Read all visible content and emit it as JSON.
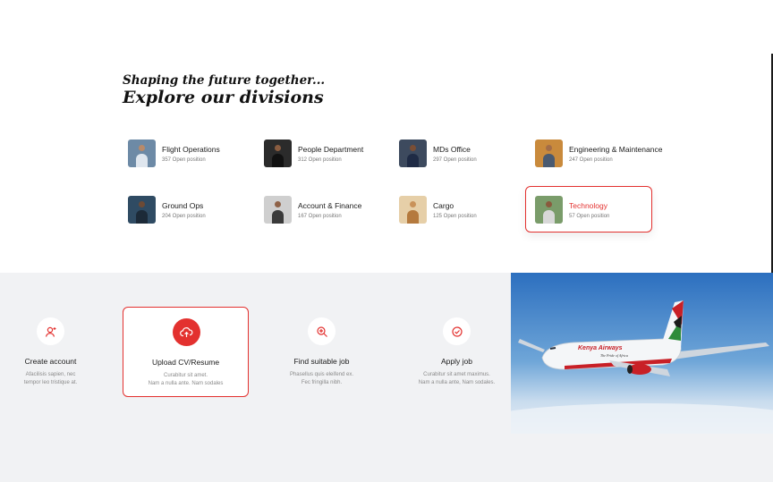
{
  "header": {
    "tagline": "Shaping the future together...",
    "title": "Explore our divisions"
  },
  "divisions": [
    {
      "name": "Flight Operations",
      "count": "357 Open position",
      "thumb_bg": "#6d8aa6",
      "fig": "#dfe6ee",
      "head": "#b88a6a"
    },
    {
      "name": "People Department",
      "count": "312 Open position",
      "thumb_bg": "#2b2b2b",
      "fig": "#111111",
      "head": "#8a5c40"
    },
    {
      "name": "MDs Office",
      "count": "297 Open position",
      "thumb_bg": "#3d4a5e",
      "fig": "#1f2b45",
      "head": "#7a4e35"
    },
    {
      "name": "Engineering & Maintenance",
      "count": "247 Open position",
      "thumb_bg": "#c98a3c",
      "fig": "#4a5a70",
      "head": "#a36d48"
    },
    {
      "name": "Ground Ops",
      "count": "204 Open position",
      "thumb_bg": "#2f4b63",
      "fig": "#1c2a38",
      "head": "#6d4a35"
    },
    {
      "name": "Account & Finance",
      "count": "167 Open position",
      "thumb_bg": "#cfcfcf",
      "fig": "#3a3a3a",
      "head": "#8f6248"
    },
    {
      "name": "Cargo",
      "count": "125 Open position",
      "thumb_bg": "#e6cfa8",
      "fig": "#b57a3e",
      "head": "#c9925a"
    },
    {
      "name": "Technology",
      "count": "57 Open position",
      "thumb_bg": "#7a9c6a",
      "fig": "#d8d8d8",
      "head": "#8a5a3d"
    }
  ],
  "steps": [
    {
      "title": "Create account",
      "desc1": "Afacilisis sapien, nec",
      "desc2": "tempor leo tristique at.",
      "icon": "add-user-icon"
    },
    {
      "title": "Upload CV/Resume",
      "desc1": "Curabitur sit amet.",
      "desc2": "Nam a nulla ante. Nam sodales",
      "icon": "cloud-upload-icon"
    },
    {
      "title": "Find suitable job",
      "desc1": "Phasellus quis eleifend ex.",
      "desc2": "Fec fringilla nibh.",
      "icon": "search-plus-icon"
    },
    {
      "title": "Apply job",
      "desc1": "Curabitur sit amet maximus.",
      "desc2": "Nam a nulla ante, Nam sodales.",
      "icon": "check-badge-icon"
    }
  ],
  "plane": {
    "brand": "Kenya Airways",
    "slogan": "The Pride of Africa"
  },
  "colors": {
    "accent": "#e3312f",
    "band": "#f1f2f4"
  }
}
